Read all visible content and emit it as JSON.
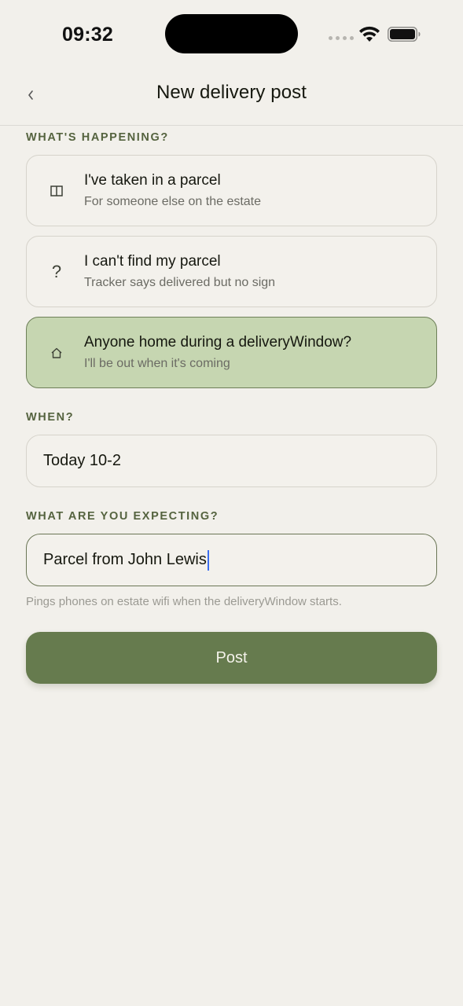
{
  "status_bar": {
    "time": "09:32",
    "icons": [
      "cellular-icon",
      "wifi-icon",
      "battery-icon"
    ]
  },
  "nav": {
    "back_icon": "chevron-left-icon",
    "title": "New delivery post"
  },
  "happening": {
    "label": "WHAT'S HAPPENING?",
    "options": [
      {
        "icon": "parcel-box-icon",
        "glyph": "◫",
        "title": "I've taken in a parcel",
        "subtitle": "For someone else on the estate",
        "selected": false
      },
      {
        "icon": "question-icon",
        "glyph": "?",
        "title": "I can't find my parcel",
        "subtitle": "Tracker says delivered but no sign",
        "selected": false
      },
      {
        "icon": "home-icon",
        "glyph": "⌂",
        "title": "Anyone home during a deliveryWindow?",
        "subtitle": "I'll be out when it's coming",
        "selected": true
      }
    ]
  },
  "when": {
    "label": "WHEN?",
    "value": "Today 10-2"
  },
  "expecting": {
    "label": "WHAT ARE YOU EXPECTING?",
    "value": "Parcel from John Lewis"
  },
  "hint": "Pings phones on estate wifi when the deliveryWindow starts.",
  "post_button": {
    "label": "Post"
  },
  "colors": {
    "background": "#f2f0eb",
    "accent": "#667b4e",
    "selected_fill": "#c6d6b1",
    "section_label": "#55633f"
  }
}
